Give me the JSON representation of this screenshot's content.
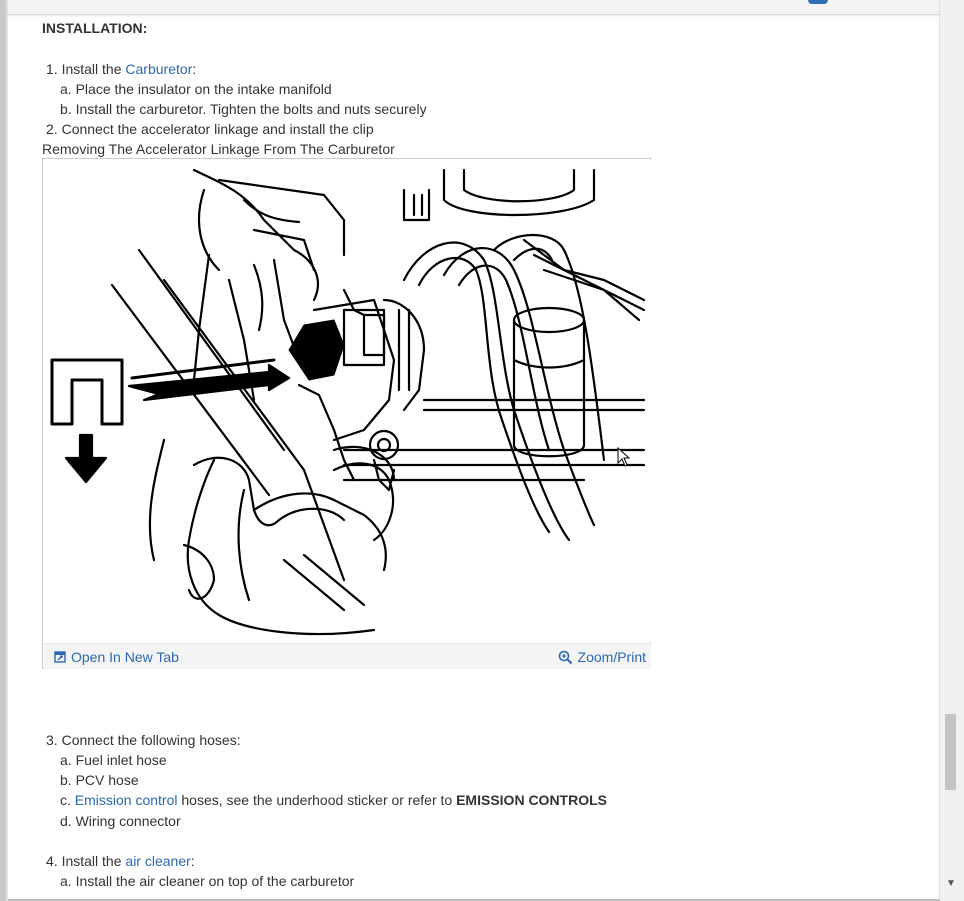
{
  "section_heading": "INSTALLATION:",
  "steps": {
    "s1": {
      "num": "1.",
      "pre": "Install the ",
      "link": "Carburetor",
      "post": ":"
    },
    "s1a": {
      "letter": "a.",
      "text": "Place the insulator on the intake manifold"
    },
    "s1b": {
      "letter": "b.",
      "text": "Install the carburetor. Tighten the bolts and nuts securely"
    },
    "s2": {
      "num": "2.",
      "text": "Connect the accelerator linkage and install the clip"
    },
    "s3": {
      "num": "3.",
      "text": "Connect the following hoses:"
    },
    "s3a": {
      "letter": "a.",
      "text": "Fuel inlet hose"
    },
    "s3b": {
      "letter": "b.",
      "text": "PCV hose"
    },
    "s3c": {
      "letter": "c.",
      "link": "Emission control",
      "mid": " hoses, see the underhood sticker or refer to ",
      "bold": "EMISSION CONTROLS"
    },
    "s3d": {
      "letter": "d.",
      "text": "Wiring connector"
    },
    "s4": {
      "num": "4.",
      "pre": "Install the ",
      "link": "air cleaner",
      "post": ":"
    },
    "s4a": {
      "letter": "a.",
      "text": "Install the air cleaner on top of the carburetor"
    }
  },
  "figure": {
    "caption": "Removing The Accelerator Linkage From The Carburetor",
    "open_new_tab": "Open In New Tab",
    "zoom_print": "Zoom/Print",
    "icons": [
      "open-tab-icon",
      "magnifier-icon"
    ]
  },
  "colors": {
    "link": "#2c67b0",
    "text": "#333333",
    "accent": "#2d6fb5"
  }
}
